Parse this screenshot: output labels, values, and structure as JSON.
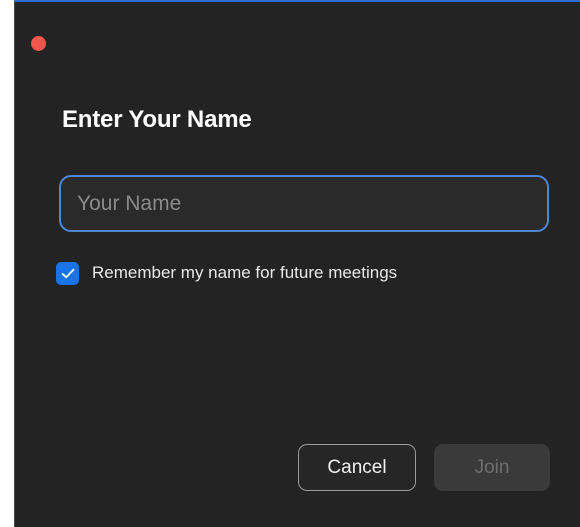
{
  "window": {
    "title": "Enter Your Name",
    "accent_color": "#1a73e8",
    "close_color": "#f0564c"
  },
  "name_field": {
    "value": "",
    "placeholder": "Your Name"
  },
  "remember": {
    "checked": true,
    "label": "Remember my name for future meetings",
    "icon": "checkmark-icon"
  },
  "buttons": {
    "cancel_label": "Cancel",
    "join_label": "Join",
    "join_enabled": false
  }
}
